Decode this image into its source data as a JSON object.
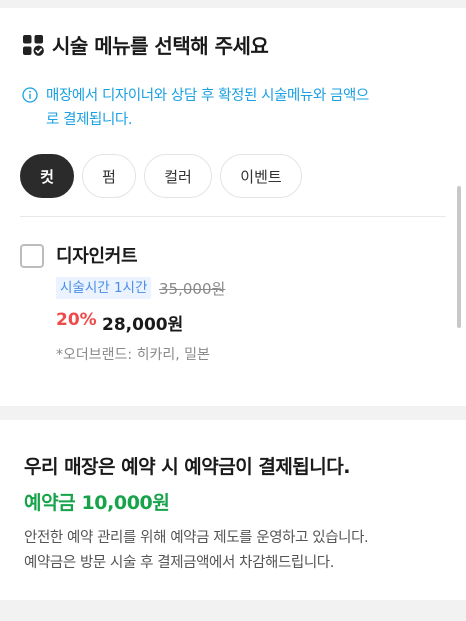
{
  "header": {
    "title": "시술 메뉴를 선택해 주세요",
    "title_icon": "menu-check-icon"
  },
  "notice": {
    "icon": "info-icon",
    "line1": "매장에서 디자이너와 상담 후 확정된 시술메뉴와 금액으",
    "line2": "로 결제됩니다."
  },
  "tabs": [
    {
      "label": "컷",
      "active": true
    },
    {
      "label": "펌",
      "active": false
    },
    {
      "label": "컬러",
      "active": false
    },
    {
      "label": "이벤트",
      "active": false
    }
  ],
  "menu_items": [
    {
      "name": "디자인커트",
      "checked": false,
      "duration": "시술시간 1시간",
      "original_price": "35,000원",
      "discount": "20%",
      "sale_price": "28,000원",
      "note": "*오더브랜드: 히카리, 밀본"
    }
  ],
  "deposit": {
    "heading": "우리 매장은 예약 시 예약금이 결제됩니다.",
    "amount": "예약금 10,000원",
    "desc_line1": "안전한 예약 관리를 위해 예약금 제도를 운영하고 있습니다.",
    "desc_line2": "예약금은 방문 시술 후 결제금액에서 차감해드립니다."
  },
  "colors": {
    "notice": "#1ba0e2",
    "discount": "#ef4b4b",
    "deposit_amount": "#17a34a",
    "active_tab": "#2b2b2b"
  }
}
